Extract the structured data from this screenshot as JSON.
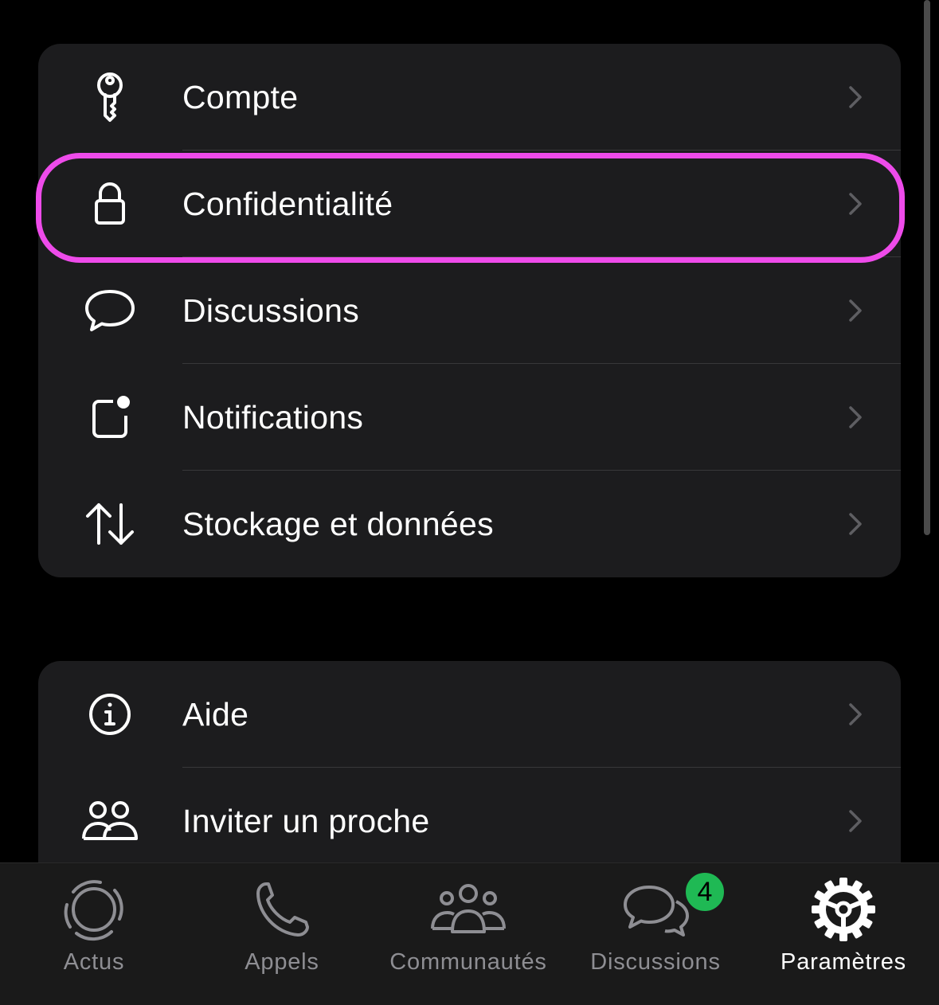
{
  "settings_group_1": {
    "items": [
      {
        "label": "Compte",
        "icon": "key-icon"
      },
      {
        "label": "Confidentialité",
        "icon": "lock-icon"
      },
      {
        "label": "Discussions",
        "icon": "chat-bubble-icon"
      },
      {
        "label": "Notifications",
        "icon": "notification-icon"
      },
      {
        "label": "Stockage et données",
        "icon": "arrows-updown-icon"
      }
    ]
  },
  "settings_group_2": {
    "items": [
      {
        "label": "Aide",
        "icon": "info-icon"
      },
      {
        "label": "Inviter un proche",
        "icon": "people-icon"
      }
    ]
  },
  "highlighted_item": "Confidentialité",
  "highlight_color": "#ee4bea",
  "tab_bar": {
    "tabs": [
      {
        "label": "Actus",
        "icon": "updates-icon",
        "active": false
      },
      {
        "label": "Appels",
        "icon": "phone-icon",
        "active": false
      },
      {
        "label": "Communautés",
        "icon": "communities-icon",
        "active": false
      },
      {
        "label": "Discussions",
        "icon": "chats-icon",
        "active": false,
        "badge": "4"
      },
      {
        "label": "Paramètres",
        "icon": "settings-gear-icon",
        "active": true
      }
    ],
    "badge_color": "#1fb954"
  }
}
